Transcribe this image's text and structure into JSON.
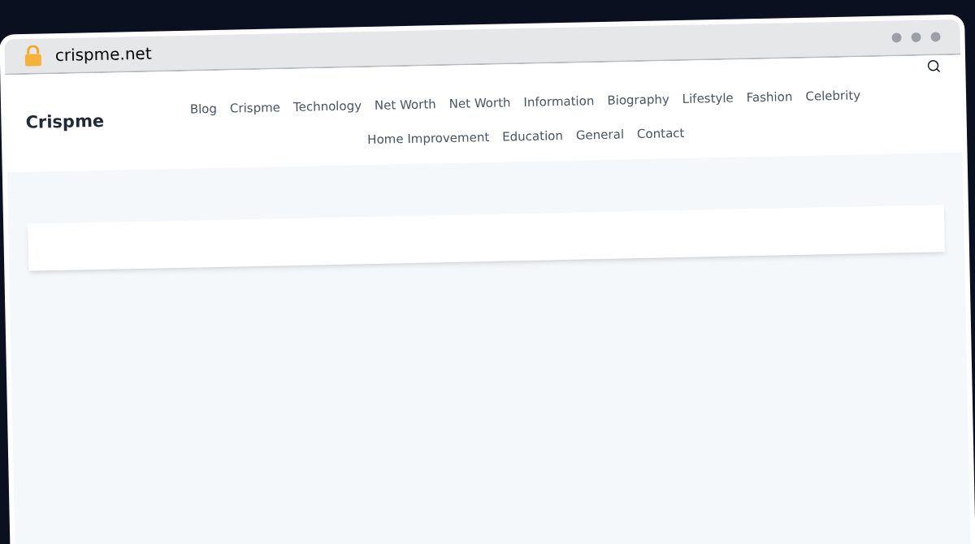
{
  "browser": {
    "address": "crispme.net"
  },
  "site": {
    "logo": "Crispme",
    "nav": [
      "Blog",
      "Crispme",
      "Technology",
      "Net Worth",
      "Net Worth",
      "Information",
      "Biography",
      "Lifestyle",
      "Fashion",
      "Celebrity",
      "Home Improvement",
      "Education",
      "General",
      "Contact"
    ]
  }
}
